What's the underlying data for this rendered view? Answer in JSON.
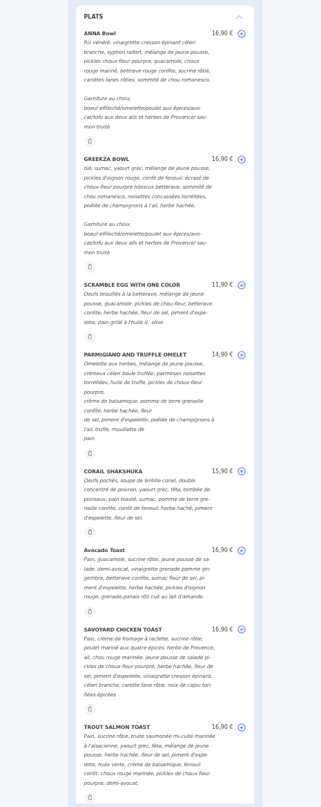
{
  "section": {
    "title": "PLATS",
    "expanded": true
  },
  "dishes": [
    {
      "name": "ANNA Bowl",
      "price": "16,90 €",
      "paragraphs": [
        [
          "Riz vénéré, vinaigrette cresson épinard céleri",
          "branche, syphon raifort, mélange de jeune pousse,",
          "pickles choux-fleur pourpre, guacamole, choux",
          "rouge mariné, bettrave rouge confite, sucrine rôtie,",
          "carottes fanes rôties, sommité de chou romanesco."
        ],
        [
          "Garniture au choix:",
          "boeuf effiloché/omelette/poulet aux épices/avo-",
          "cat/tofu aux deux ails et herbes de Provence/ sau-",
          "mon truité"
        ]
      ]
    },
    {
      "name": "GREEKZA BOWL",
      "price": "16,90 €",
      "paragraphs": [
        [
          "blé, sumac, yaourt grec, mélange de jeune pousse,",
          "pickles d'oignon rouge, confit de fenouil, écrasé de",
          "choux-fleur pourpre hibiscus betterave, sommité de",
          "chou romanesco, noisettes concassées torréfiées,",
          "poêlée de champignons à l'ail, herbe hachée."
        ],
        [
          "Garniture au choix:",
          "boeuf effiloché/omelette/poulet aux épices/avo-",
          "cat/tofu aux deux ails et herbes de Provence/ sau-",
          "mon truité"
        ]
      ]
    },
    {
      "name": "SCRAMBLE EGG WITH ONE COLOR",
      "price": "11,90 €",
      "paragraphs": [
        [
          "Oeufs brouillés à la betterave, mélange de jeune",
          "pousse, guacamole, pickles de chou-fleur, betterave",
          "confite, herbe hachée, fleur de sel, piment d'espe-",
          "lette, pain grillé à l'huile d´ olive"
        ]
      ]
    },
    {
      "name": "PARMIGIANO AND TRUFFLE OMELET",
      "price": "14,90 €",
      "paragraphs": [
        [
          "Omelette aux herbes, mélange de jeune pousse,",
          "crémeux céleri boule truffée, parmesan noisettes",
          "torréfiées, huile de truffe, pickles de choux-fleur",
          "pourpre,",
          "crème de balsamique, pomme de terre grenaille",
          "confite, herbe hachée, fleur",
          "de sel, piment d'espelette, poêlée de champignons à",
          "l'ail, truffe, mouillette de",
          "pain"
        ]
      ]
    },
    {
      "name": "CORAIL SHAKSHUKA",
      "price": "15,90 €",
      "paragraphs": [
        [
          "Oeufs pochés, soupe de lentille corail, double",
          "concentré de poivron, yaourt grec, féta, tombée de",
          "poireaux, pain toasté, sumac, pomme de terre gre-",
          "naille confite, confit de fenouil, herbe haché, piment",
          "d'espelette, fleur de sel."
        ]
      ]
    },
    {
      "name": "Avocado Toast",
      "price": "16,90 €",
      "paragraphs": [
        [
          "Pain, guacamole, sucrine rôtie, jeune pousse de sa-",
          "lade, demi-avocat, vinaigrette grenade pomme gin-",
          "gembre, betterave confite, sumac fleur de sel, pi-",
          "ment d'espelette, herbe hachée, pickles d'oignon",
          "rouge, grenade,panais rôti cuit au lait d'amande."
        ]
      ]
    },
    {
      "name": "SAVOYARD CHICKEN TOAST",
      "price": "16,90 €",
      "paragraphs": [
        [
          "Pain, crème de fromage à raclette, sucrine rôtie,",
          "poulet mariné aux quatre épices, herbe de Provence,",
          "ail, chou rouge marinée, jeune pousse de salade pi-",
          "ckles de choux-fleur pourpre, herbe hachée, fleur de",
          "sel, piment d'espelette, vinaigrette cresson épinard,",
          "céleri branche, carotte fane rôtie, noix de cajou tori-",
          "fiées épicées"
        ]
      ]
    },
    {
      "name": "TROUT SALMON TOAST",
      "price": "16,90 €",
      "paragraphs": [
        [
          "Pain, sucrine rôtie, truite saumonée mi-cuite marinée",
          "à l'alsacienne, yaourt grec, féta, mélange de jeune",
          "pousse, herbe hachée, fleur de sel, piment d'espe-",
          "lette, huile verte, crème de balsamique, fenouil",
          "confit, choux rouge marinée, pickles de choux fleur",
          "pourpre, demi-avocat,"
        ]
      ]
    }
  ]
}
